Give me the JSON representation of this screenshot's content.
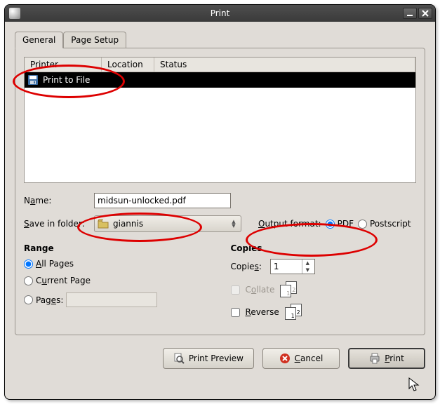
{
  "window": {
    "title": "Print"
  },
  "tabs": {
    "general": "General",
    "page_setup": "Page Setup"
  },
  "printer_table": {
    "headers": {
      "printer": "Printer",
      "location": "Location",
      "status": "Status"
    },
    "rows": [
      {
        "name": "Print to File"
      }
    ]
  },
  "name": {
    "label_pre": "N",
    "label_underline": "a",
    "label_post": "me:",
    "value": "midsun-unlocked.pdf"
  },
  "folder": {
    "label_pre": "",
    "label_underline": "S",
    "label_post": "ave in folder:",
    "value": "giannis"
  },
  "output_format": {
    "label_pre": "",
    "label_underline": "O",
    "label_post": "utput format:",
    "pdf": "PDF",
    "postscript": "Postscript"
  },
  "range": {
    "title": "Range",
    "all_pre": "",
    "all_u": "A",
    "all_post": "ll Pages",
    "current_pre": "C",
    "current_u": "u",
    "current_post": "rrent Page",
    "pages_pre": "Pag",
    "pages_u": "e",
    "pages_post": "s:"
  },
  "copies": {
    "title": "Copies",
    "label_pre": "Copie",
    "label_u": "s",
    "label_post": ":",
    "value": "1",
    "collate_pre": "C",
    "collate_u": "o",
    "collate_post": "llate",
    "reverse_pre": "",
    "reverse_u": "R",
    "reverse_post": "everse",
    "page_back": "2",
    "page_front": "1"
  },
  "buttons": {
    "preview": "Print Preview",
    "cancel_u": "C",
    "cancel_post": "ancel",
    "print_u": "P",
    "print_post": "rint"
  }
}
